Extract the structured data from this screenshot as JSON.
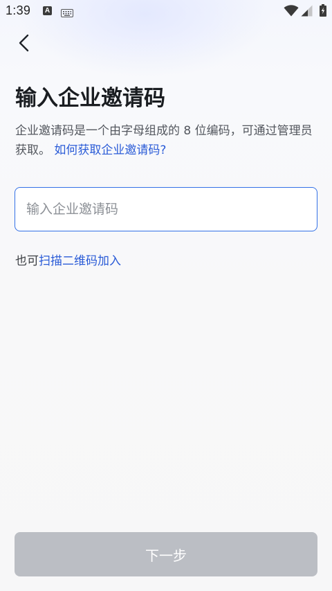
{
  "status_bar": {
    "time": "1:39",
    "notification_icon_letter": "A",
    "icons": [
      "a-notification-icon",
      "keyboard-icon",
      "wifi-icon",
      "cellular-signal-icon",
      "battery-charging-icon"
    ]
  },
  "header": {
    "back_icon": "chevron-left-icon"
  },
  "main": {
    "title": "输入企业邀请码",
    "description": "企业邀请码是一个由字母组成的 8 位编码，可通过管理员获取。",
    "help_link": "如何获取企业邀请码?",
    "input": {
      "value": "",
      "placeholder": "输入企业邀请码"
    },
    "scan_prefix": "也可",
    "scan_link": "扫描二维码加入"
  },
  "footer": {
    "next_label": "下一步"
  },
  "colors": {
    "accent": "#2a5bd7",
    "input_border": "#3370e6",
    "button_disabled": "#bbbec4"
  }
}
